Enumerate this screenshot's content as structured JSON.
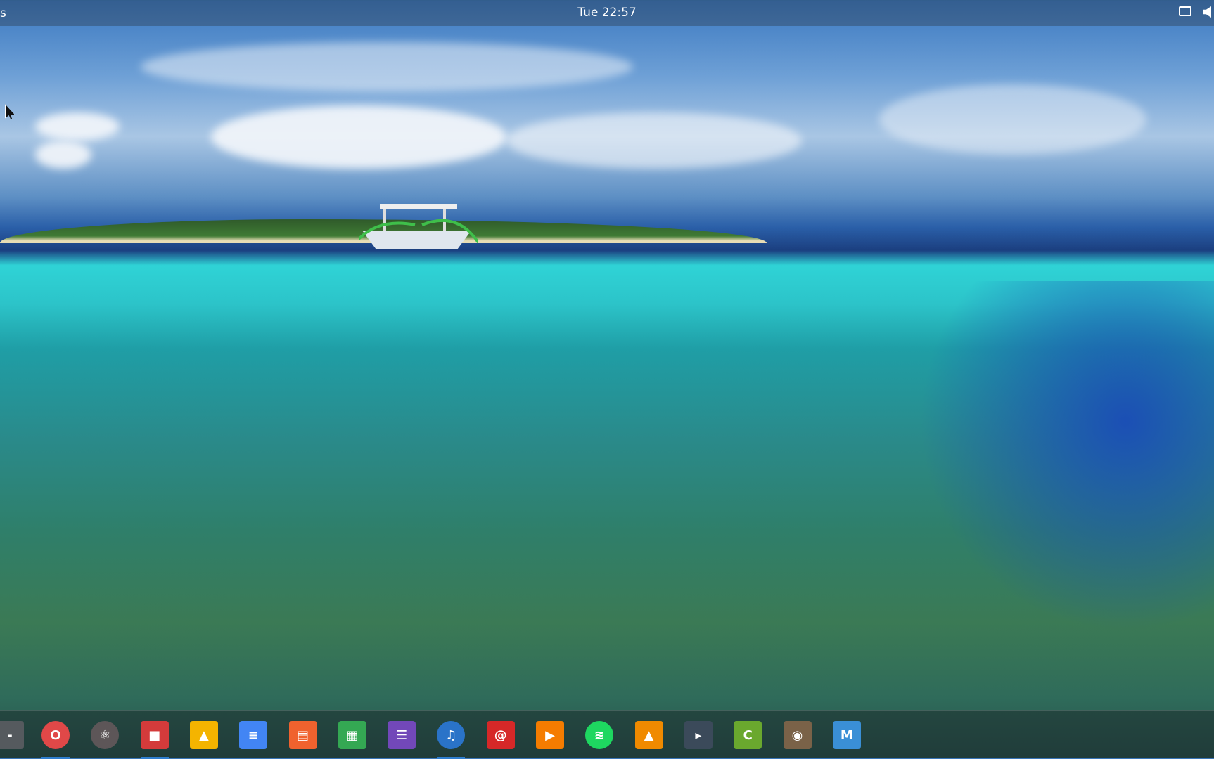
{
  "topbar": {
    "activities": "s",
    "clock": "Tue 22:57",
    "tray": [
      "screen-icon",
      "volume-icon"
    ]
  },
  "dock": {
    "apps": [
      {
        "name": "show-desktop",
        "color": "#555a5e",
        "glyph": "-"
      },
      {
        "name": "opera",
        "color": "#e04848",
        "glyph": "O"
      },
      {
        "name": "atom",
        "color": "#5d5658",
        "glyph": "⚛"
      },
      {
        "name": "screen-recorder",
        "color": "#d43b3b",
        "glyph": "■"
      },
      {
        "name": "google-drive",
        "color": "#f4b400",
        "glyph": "▲"
      },
      {
        "name": "google-docs",
        "color": "#4285f4",
        "glyph": "≡"
      },
      {
        "name": "google-slides",
        "color": "#f0622e",
        "glyph": "▤"
      },
      {
        "name": "google-sheets",
        "color": "#34a853",
        "glyph": "▦"
      },
      {
        "name": "google-forms",
        "color": "#7248b9",
        "glyph": "☰"
      },
      {
        "name": "audio-player",
        "color": "#2a73c8",
        "glyph": "♫"
      },
      {
        "name": "netease-music",
        "color": "#d62828",
        "glyph": "@"
      },
      {
        "name": "google-play-music",
        "color": "#f57c00",
        "glyph": "▶"
      },
      {
        "name": "spotify",
        "color": "#1ed760",
        "glyph": "≋"
      },
      {
        "name": "vlc",
        "color": "#f08a00",
        "glyph": "▲"
      },
      {
        "name": "kdenlive",
        "color": "#3b4a5a",
        "glyph": "▸"
      },
      {
        "name": "system-cleaner",
        "color": "#6aa82e",
        "glyph": "C"
      },
      {
        "name": "gimp",
        "color": "#7a6248",
        "glyph": "◉"
      },
      {
        "name": "presentation",
        "color": "#3a8fd6",
        "glyph": "M"
      }
    ]
  }
}
